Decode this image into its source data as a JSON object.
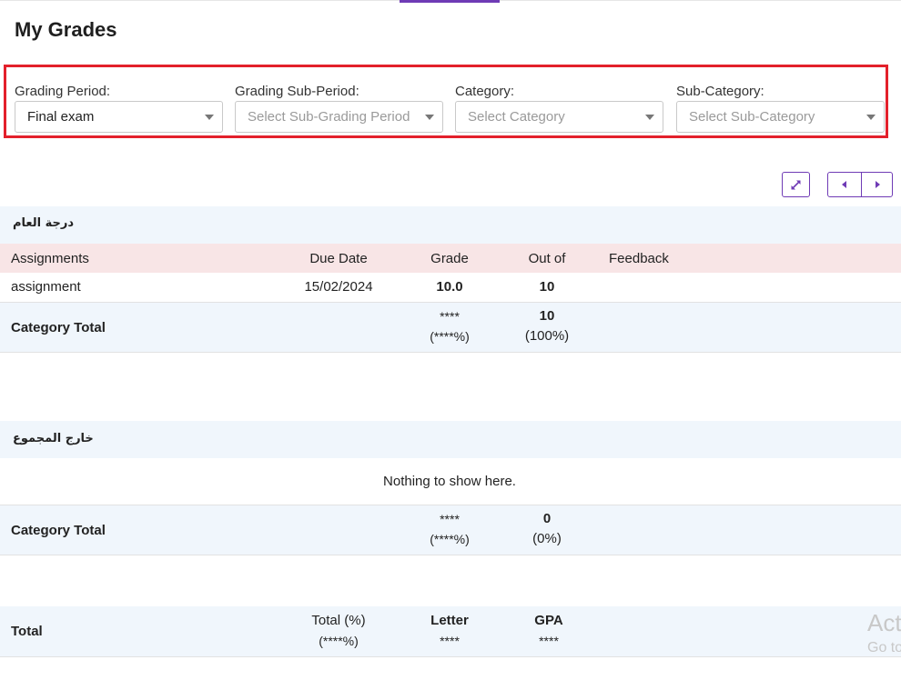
{
  "page": {
    "title": "My Grades"
  },
  "filters": {
    "grading_period": {
      "label": "Grading Period:",
      "value": "Final exam"
    },
    "grading_sub_period": {
      "label": "Grading Sub-Period:",
      "placeholder": "Select Sub-Grading Period"
    },
    "category": {
      "label": "Category:",
      "placeholder": "Select Category"
    },
    "sub_category": {
      "label": "Sub-Category:",
      "placeholder": "Select Sub-Category"
    }
  },
  "toolbar": {
    "expand_icon": "expand-icon",
    "prev_icon": "caret-left-icon",
    "next_icon": "caret-right-icon",
    "accent_color": "#6f3bb5"
  },
  "categories": [
    {
      "name": "درجة العام",
      "headers": {
        "assignments": "Assignments",
        "due_date": "Due Date",
        "grade": "Grade",
        "out_of": "Out of",
        "feedback": "Feedback"
      },
      "rows": [
        {
          "assignment": "assignment",
          "due_date": "15/02/2024",
          "grade": "10.0",
          "out_of": "10",
          "feedback": ""
        }
      ],
      "total": {
        "label": "Category Total",
        "grade": "****",
        "grade_pct": "(****%)",
        "out_of": "10",
        "out_of_pct": "(100%)"
      }
    },
    {
      "name": "خارج المجموع",
      "empty_message": "Nothing to show here.",
      "total": {
        "label": "Category Total",
        "grade": "****",
        "grade_pct": "(****%)",
        "out_of": "0",
        "out_of_pct": "(0%)"
      }
    }
  ],
  "summary": {
    "label": "Total",
    "total_pct_label": "Total (%)",
    "total_pct_value": "(****%)",
    "letter_label": "Letter",
    "letter_value": "****",
    "gpa_label": "GPA",
    "gpa_value": "****"
  },
  "watermark": {
    "line1": "Act",
    "line2": "Go to"
  },
  "colors": {
    "highlight_border": "#e3202b",
    "header_row": "#f8e5e6",
    "band": "#f0f6fc"
  }
}
